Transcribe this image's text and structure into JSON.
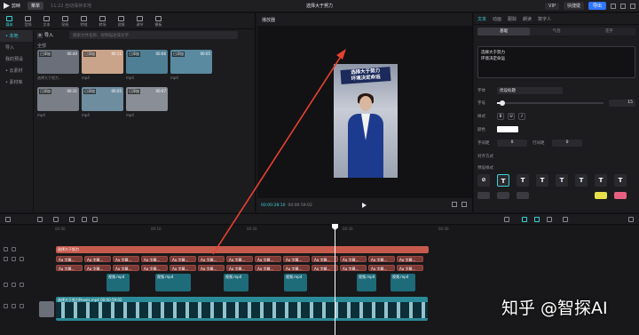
{
  "titlebar": {
    "app_name": "剪映",
    "menu_label": "菜单",
    "autosave": "11:22 自动保存本地",
    "title": "选择大于努力",
    "chip1": "VIP",
    "chip2": "快捷键",
    "export_label": "导出"
  },
  "tool_tabs": [
    {
      "label": "媒体"
    },
    {
      "label": "音频"
    },
    {
      "label": "文本"
    },
    {
      "label": "贴纸"
    },
    {
      "label": "特效"
    },
    {
      "label": "转场"
    },
    {
      "label": "滤镜"
    },
    {
      "label": "调节"
    },
    {
      "label": "模板"
    }
  ],
  "side_nav": [
    {
      "label": "• 本地"
    },
    {
      "label": "导入"
    },
    {
      "label": "我的预设"
    },
    {
      "label": "• 云素材"
    },
    {
      "label": "• 素材库"
    }
  ],
  "media": {
    "import_label": "导入",
    "search_placeholder": "搜索文件名称、视频描述或文字",
    "section_label": "全部",
    "thumbs": [
      {
        "badge": "已添加",
        "dur": "00:40",
        "cap": "选择大于努力...",
        "color": "#6a6f7a"
      },
      {
        "badge": "已添加",
        "dur": "00:11",
        "cap": "mp4",
        "color": "#c9a48a"
      },
      {
        "badge": "已添加",
        "dur": "00:06",
        "cap": "mp4",
        "color": "#4f7f94"
      },
      {
        "badge": "已添加",
        "dur": "00:05",
        "cap": "mp4",
        "color": "#5a8aa0"
      },
      {
        "badge": "已添加",
        "dur": "00:31",
        "cap": "mp4",
        "color": "#7a7e86"
      },
      {
        "badge": "已添加",
        "dur": "00:05",
        "cap": "mp4",
        "color": "#6e8ea0"
      },
      {
        "badge": "已添加",
        "dur": "00:07",
        "cap": "mp4",
        "color": "#8a8e96"
      }
    ]
  },
  "player": {
    "title": "播放器",
    "video_title_line1": "选择大于努力",
    "video_title_line2": "环境决定命运",
    "time_current": "00:00:28:10",
    "time_total": "00:00:59:02"
  },
  "props": {
    "tabs": [
      "文本",
      "动画",
      "跟踪",
      "朗读",
      "数字人"
    ],
    "sub_tabs": [
      "基础",
      "气泡",
      "花字"
    ],
    "text_line1": "选择大于努力",
    "text_line2": "环境决定命运",
    "font_label": "字体",
    "font_value": "优设标题",
    "size_label": "字号",
    "size_value": "15",
    "size_fraction": 0.05,
    "style_label": "样式",
    "style_b": "B",
    "style_u": "U",
    "style_i": "I",
    "color_label": "颜色",
    "spacing_label": "字间距",
    "spacing_value": "0",
    "line_label": "行间距",
    "line_value": "0",
    "align_label": "对齐方式",
    "preset_label": "预设样式",
    "apply_label": "保存预设"
  },
  "timeline": {
    "ruler": [
      "00:00",
      "00:10",
      "00:20",
      "00:30",
      "00:40"
    ],
    "text_track_label": "选择大于努力",
    "subtitle_label": "Aa 字幕...",
    "video_clip_label": "视频.mp4",
    "main_clip_label": "选择大于努力Pexels.mp4 00:00:59:02"
  },
  "watermark": "知乎 @智探AI"
}
